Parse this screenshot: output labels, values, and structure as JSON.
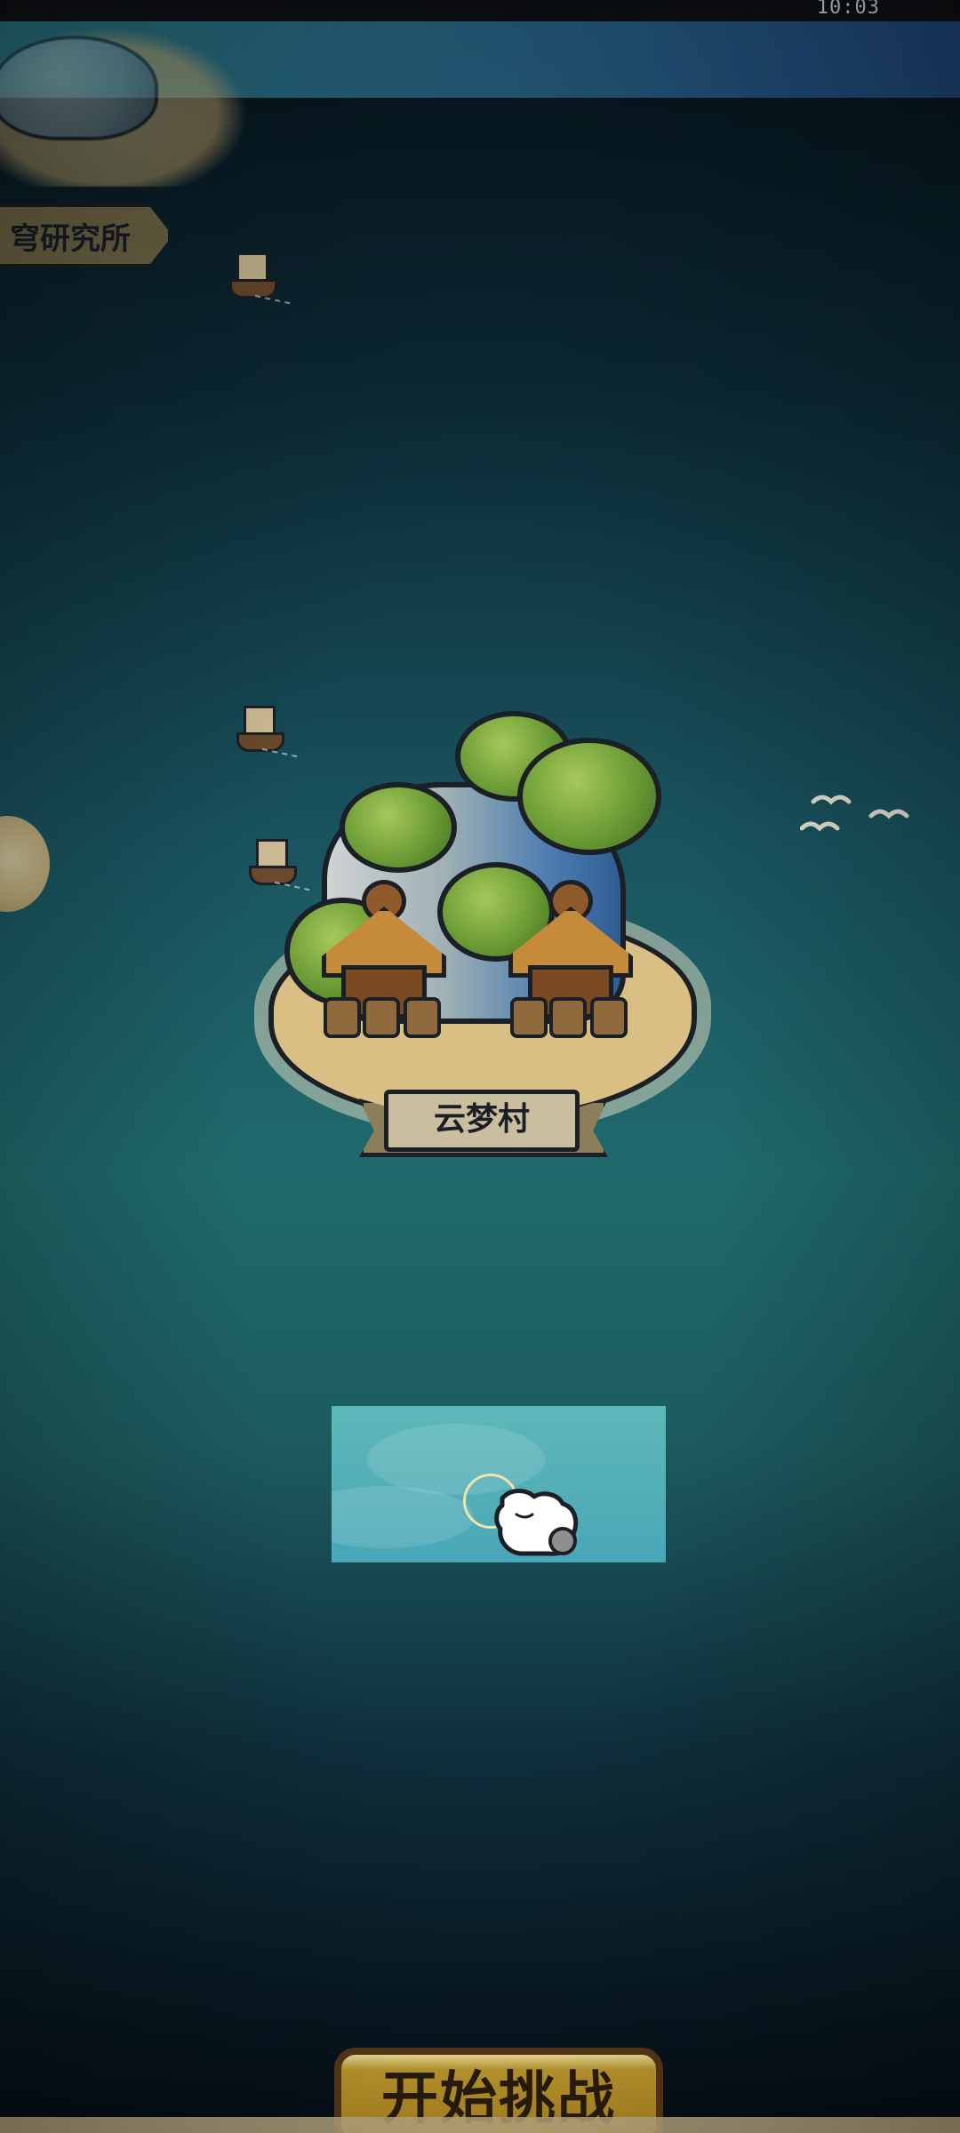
{
  "status_bar": {
    "time": "10:03"
  },
  "map": {
    "top_left_location": {
      "label": "穹研究所"
    },
    "current_island": {
      "label": "云梦村"
    }
  },
  "tutorial": {
    "hint": "tap"
  },
  "cta": {
    "label": "开始挑战"
  },
  "colors": {
    "sea_deep": "#06141c",
    "sea_mid": "#1f6a6c",
    "sand": "#d9bf83",
    "outline": "#1b1f26",
    "cta_gold": "#c59f2e"
  }
}
